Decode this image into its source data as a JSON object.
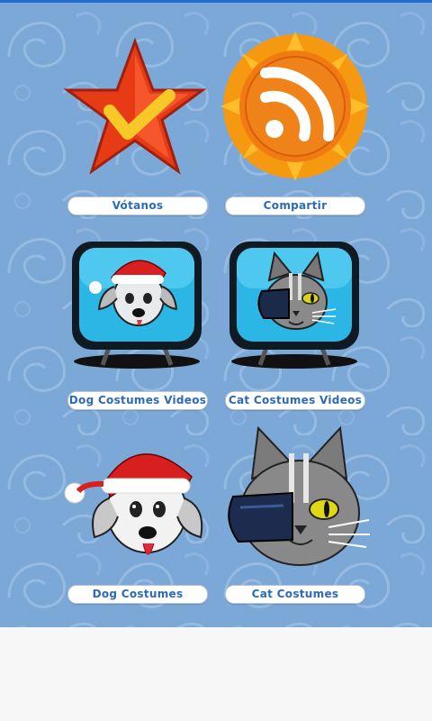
{
  "menu": {
    "items": [
      {
        "label": "Vótanos",
        "icon": "star-check-icon"
      },
      {
        "label": "Compartir",
        "icon": "rss-sun-icon"
      },
      {
        "label": "Dog Costumes Videos",
        "icon": "dog-tv-icon"
      },
      {
        "label": "Cat Costumes Videos",
        "icon": "cat-tv-icon"
      },
      {
        "label": "Dog Costumes",
        "icon": "dog-santa-icon"
      },
      {
        "label": "Cat Costumes",
        "icon": "cat-eyepatch-icon"
      }
    ]
  },
  "colors": {
    "background_pattern": "#7ba8d7",
    "label_text": "#2d6bb8",
    "top_accent": "#1f6fd2",
    "bottom_area": "#f7f7f7"
  }
}
